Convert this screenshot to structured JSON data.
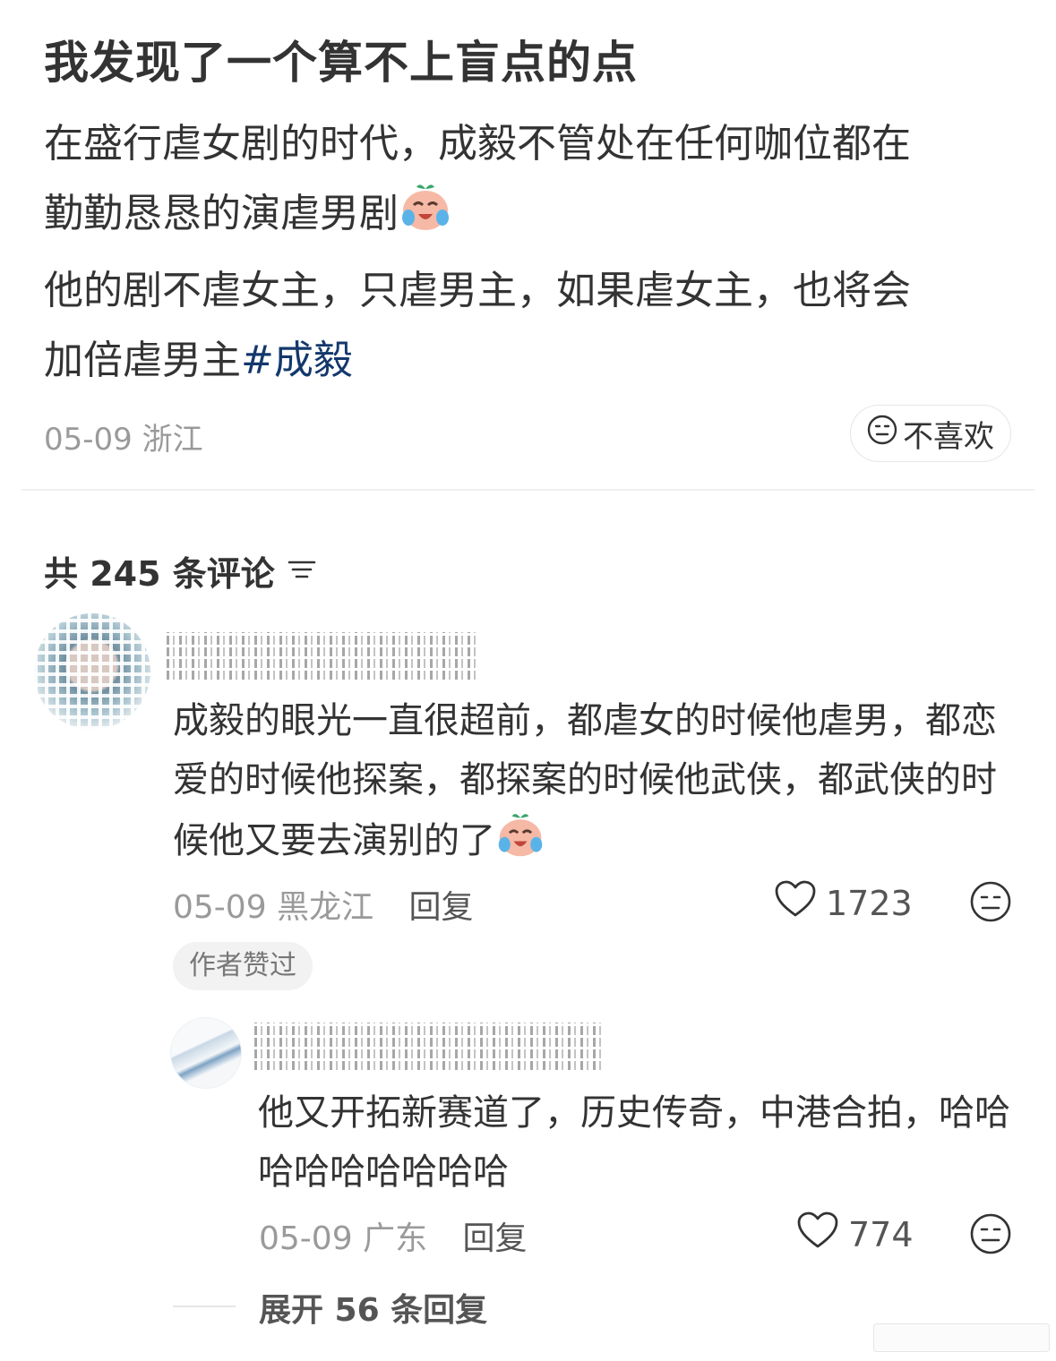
{
  "post": {
    "title": "我发现了一个算不上盲点的点",
    "line1": "在盛行虐女剧的时代，成毅不管处在任何咖位都在",
    "line2": "勤勤恳恳的演虐男剧",
    "line3": "他的剧不虐女主，只虐男主，如果虐女主，也将会",
    "line4_text": "加倍虐男主",
    "hashtag": "#成毅",
    "date": "05-09",
    "location": "浙江",
    "dislike_label": "不喜欢"
  },
  "comments_header": {
    "label": "共 245 条评论"
  },
  "comments": [
    {
      "text": "成毅的眼光一直很超前，都虐女的时候他虐男，都恋爱的时候他探案，都探案的时候他武侠，都武侠的时候他又要去演别的了",
      "date": "05-09",
      "location": "黑龙江",
      "reply_label": "回复",
      "likes": "1723",
      "badge": "作者赞过"
    },
    {
      "text": "他又开拓新赛道了，历史传奇，中港合拍，哈哈哈哈哈哈哈哈哈",
      "date": "05-09",
      "location": "广东",
      "reply_label": "回复",
      "likes": "774"
    }
  ],
  "expand_replies": {
    "label": "展开 56 条回复"
  },
  "colors": {
    "text": "#333333",
    "meta": "#9a9a9a",
    "hashtag": "#13386c",
    "divider": "#f0f0f0"
  },
  "icons": [
    "crying-laughing-emoji-icon",
    "neutral-face-icon",
    "sort-icon",
    "heart-icon"
  ]
}
